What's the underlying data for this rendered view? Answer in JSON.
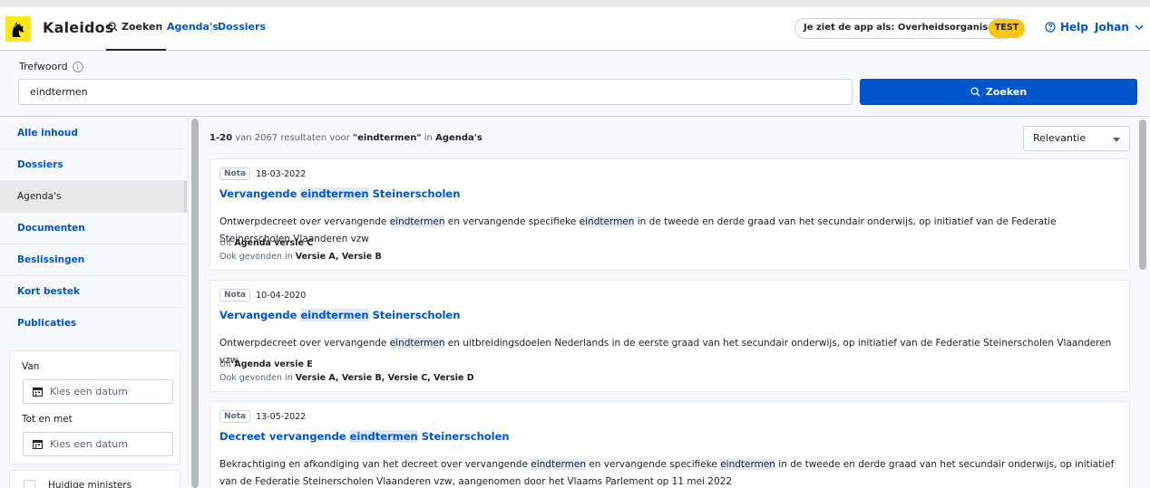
{
  "header": {
    "brand": "Kaleidos",
    "nav": [
      {
        "label": "Zoeken",
        "active": true
      },
      {
        "label": "Agenda's"
      },
      {
        "label": "Dossiers"
      }
    ],
    "role_pill": "Je ziet de app als: Overheidsorganisatie",
    "env_badge": "TEST",
    "help_label": "Help",
    "user_name": "Johan",
    "accent": "#0055cc",
    "badge_color": "#ffc515"
  },
  "search": {
    "label": "Trefwoord",
    "value": "eindtermen",
    "button_label": "Zoeken"
  },
  "sidebar": {
    "items": [
      {
        "label": "Alle inhoud"
      },
      {
        "label": "Dossiers"
      },
      {
        "label": "Agenda's",
        "active": true
      },
      {
        "label": "Documenten"
      },
      {
        "label": "Beslissingen"
      },
      {
        "label": "Kort bestek"
      },
      {
        "label": "Publicaties"
      }
    ],
    "date_from_label": "Van",
    "date_to_label": "Tot en met",
    "date_placeholder": "Kies een datum",
    "ministers_label": "Huidige ministers"
  },
  "results": {
    "summary": {
      "range": "1-20",
      "mid1": " van 2067 resultaten voor ",
      "query": "\"eindtermen\"",
      "mid2": " in ",
      "scope": "Agenda's"
    },
    "sort_value": "Relevantie",
    "cards": [
      {
        "type": "Nota",
        "date": "18-03-2022",
        "title_pre": "Vervangende ",
        "title_hl": "eindtermen",
        "title_post": " Steinerscholen",
        "body": [
          {
            "t": "Ontwerpdecreet over vervangende "
          },
          {
            "t": "eindtermen",
            "hl": true
          },
          {
            "t": " en vervangende specifieke "
          },
          {
            "t": "eindtermen",
            "hl": true
          },
          {
            "t": " in de tweede en derde graad van het secundair onderwijs, op initiatief van de Federatie Steinerscholen Vlaanderen vzw"
          }
        ],
        "from_prefix": "Uit ",
        "from_value": "Agenda versie C",
        "also_prefix": "Ook gevonden in ",
        "also_value": "Versie A, Versie B"
      },
      {
        "type": "Nota",
        "date": "10-04-2020",
        "title_pre": "Vervangende ",
        "title_hl": "eindtermen",
        "title_post": " Steinerscholen",
        "body": [
          {
            "t": "Ontwerpdecreet over vervangende "
          },
          {
            "t": "eindtermen",
            "hl": true
          },
          {
            "t": " en uitbreidingsdoelen Nederlands in de eerste graad van het secundair onderwijs, op initiatief van de Federatie Steinerscholen Vlaanderen vzw"
          }
        ],
        "from_prefix": "Uit ",
        "from_value": "Agenda versie E",
        "also_prefix": "Ook gevonden in ",
        "also_value": "Versie A, Versie B, Versie C, Versie D"
      },
      {
        "type": "Nota",
        "date": "13-05-2022",
        "title_pre": "Decreet vervangende ",
        "title_hl": "eindtermen",
        "title_post": " Steinerscholen",
        "body": [
          {
            "t": "Bekrachtiging en afkondiging van het decreet over vervangende "
          },
          {
            "t": "eindtermen",
            "hl": true
          },
          {
            "t": " en vervangende specifieke "
          },
          {
            "t": "eindtermen",
            "hl": true
          },
          {
            "t": " in de tweede en derde graad van het secundair onderwijs, op initiatief van de Federatie Steinerscholen Vlaanderen vzw, aangenomen door het Vlaams Parlement op 11 mei 2022"
          }
        ]
      }
    ]
  }
}
